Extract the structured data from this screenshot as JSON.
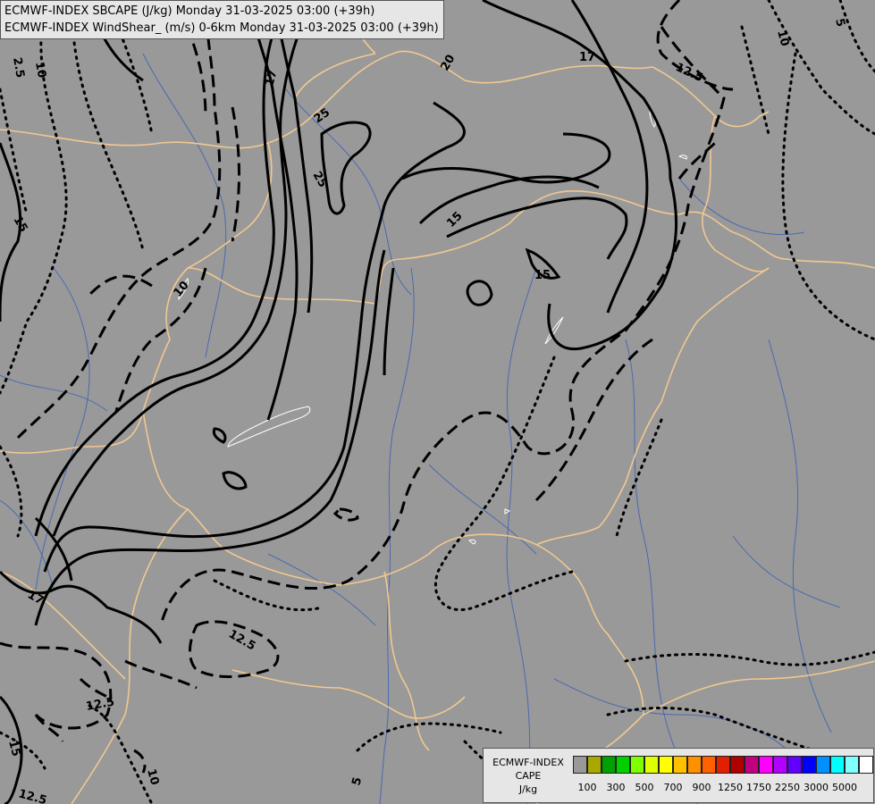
{
  "header": {
    "line1": "ECMWF-INDEX SBCAPE (J/kg) Monday 31-03-2025 03:00 (+39h)",
    "line2": "ECMWF-INDEX WindShear_ (m/s) 0-6km Monday 31-03-2025 03:00 (+39h)"
  },
  "contour_labels": [
    "25",
    "25",
    "20",
    "17",
    "17",
    "12.5",
    "10",
    "5",
    "15",
    "15",
    "10",
    "2.5",
    "10",
    "15",
    "17",
    "12.5",
    "12.5",
    "15",
    "12.5",
    "10",
    "5"
  ],
  "legend": {
    "title_line1": "ECMWF-INDEX",
    "title_line2": "CAPE",
    "title_line3": "J/kg",
    "colors": [
      "#999999",
      "#a8a800",
      "#00a000",
      "#00d000",
      "#80ff00",
      "#e0ff00",
      "#ffff00",
      "#ffc000",
      "#ff9000",
      "#ff6000",
      "#e02000",
      "#b00000",
      "#c00080",
      "#ff00ff",
      "#b000ff",
      "#6000ff",
      "#0000ff",
      "#0090ff",
      "#00ffff",
      "#80ffff",
      "#ffffff"
    ],
    "ticks": [
      "100",
      "300",
      "500",
      "700",
      "900",
      "1250",
      "1750",
      "2250",
      "3000",
      "5000"
    ]
  }
}
